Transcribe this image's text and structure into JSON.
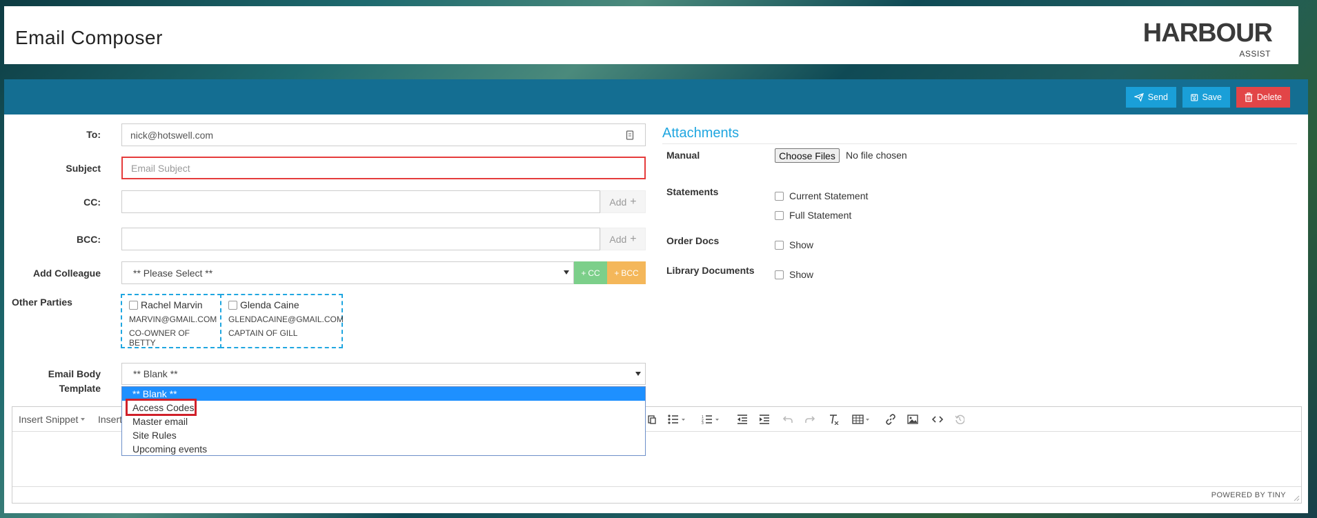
{
  "header": {
    "title": "Email Composer",
    "logo_main": "HARBOUR",
    "logo_sub": "ASSIST"
  },
  "toolbar": {
    "send": "Send",
    "save": "Save",
    "delete": "Delete"
  },
  "form": {
    "to_label": "To:",
    "to_value": "nick@hotswell.com",
    "subject_label": "Subject",
    "subject_placeholder": "Email Subject",
    "cc_label": "CC:",
    "bcc_label": "BCC:",
    "add_label": "Add",
    "colleague_label": "Add Colleague",
    "colleague_selected": "** Please Select **",
    "cc_button": "CC",
    "bcc_button": "BCC",
    "other_parties_label": "Other Parties",
    "parties": [
      {
        "name": "Rachel Marvin",
        "email": "MARVIN@GMAIL.COM",
        "role": "CO-OWNER OF BETTY"
      },
      {
        "name": "Glenda Caine",
        "email": "GLENDACAINE@GMAIL.COM",
        "role": "CAPTAIN OF GILL"
      }
    ],
    "template_label_1": "Email Body",
    "template_label_2": "Template",
    "template_selected": "** Blank **",
    "template_options": [
      "** Blank **",
      "Access Codes",
      "Master email",
      "Site Rules",
      "Upcoming events"
    ]
  },
  "editor": {
    "insert_snippet": "Insert Snippet",
    "insert_partial": "Insert",
    "powered_by": "POWERED BY TINY"
  },
  "attachments": {
    "title": "Attachments",
    "manual_label": "Manual",
    "choose_files": "Choose Files",
    "no_file": "No file chosen",
    "statements_label": "Statements",
    "current_statement": "Current Statement",
    "full_statement": "Full Statement",
    "order_docs_label": "Order Docs",
    "order_docs_show": "Show",
    "library_label": "Library Documents",
    "library_show": "Show"
  },
  "colors": {
    "toolbar": "#146e92",
    "accent": "#1a9fd8",
    "danger": "#e24547",
    "cc": "#7ccf8a",
    "bcc": "#f4b75a"
  }
}
